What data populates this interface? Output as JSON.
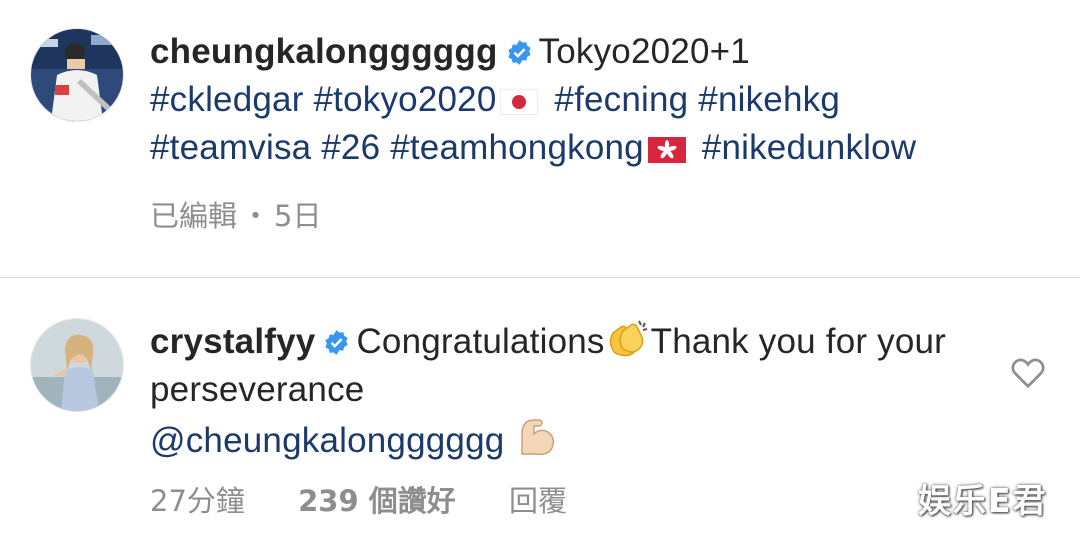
{
  "post": {
    "username": "cheungkalongggggg",
    "verified_icon": "verified-badge-icon",
    "caption_text": "Tokyo2020+1",
    "hashtags_line1": [
      "#ckledgar",
      "#tokyo2020",
      "#fecning",
      "#nikehkg"
    ],
    "hashtags_line2": [
      "#teamvisa",
      "#26",
      "#teamhongkong",
      "#nikedunklow"
    ],
    "flags": {
      "japan": "japan-flag-icon",
      "hongkong": "hongkong-flag-icon"
    },
    "edited_label": "已編輯",
    "separator": "・",
    "time_ago": "5日"
  },
  "reply": {
    "username": "crystalfyy",
    "text_part1": "Congratulations",
    "text_part2": "Thank you for your perseverance",
    "mention": "@cheungkalongggggg",
    "time_ago": "27分鐘",
    "likes": "239 個讚好",
    "reply_label": "回覆"
  },
  "watermark": "娱乐E君",
  "colors": {
    "text": "#262626",
    "hashtag": "#1b3a6b",
    "meta": "#8e8e8e",
    "verified": "#3897f0",
    "divider": "#dbdbdb"
  }
}
